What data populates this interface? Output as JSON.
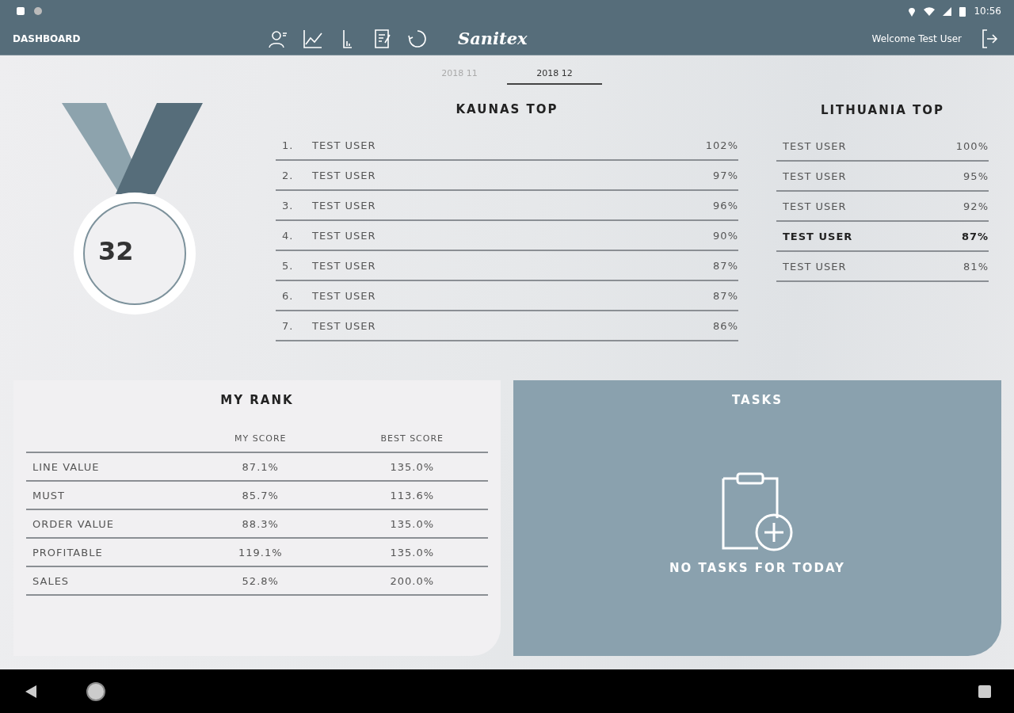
{
  "status_bar": {
    "time": "10:56"
  },
  "nav": {
    "title": "DASHBOARD",
    "brand": "Sanitex",
    "welcome": "Welcome Test User"
  },
  "periods": [
    {
      "label": "2018 11",
      "selected": false
    },
    {
      "label": "2018 12",
      "selected": true
    }
  ],
  "medal": {
    "rank": "32"
  },
  "kaunas_top": {
    "title": "KAUNAS TOP",
    "rows": [
      {
        "place": "1.",
        "name": "TEST USER",
        "score": "102%",
        "selected": false
      },
      {
        "place": "2.",
        "name": "TEST USER",
        "score": "97%",
        "selected": false
      },
      {
        "place": "3.",
        "name": "TEST USER",
        "score": "96%",
        "selected": false
      },
      {
        "place": "4.",
        "name": "TEST USER",
        "score": "90%",
        "selected": false
      },
      {
        "place": "5.",
        "name": "TEST USER",
        "score": "87%",
        "selected": false
      },
      {
        "place": "6.",
        "name": "TEST USER",
        "score": "87%",
        "selected": false
      },
      {
        "place": "7.",
        "name": "TEST USER",
        "score": "86%",
        "selected": false
      }
    ]
  },
  "lithuania_top": {
    "title": "LITHUANIA TOP",
    "rows": [
      {
        "name": "TEST USER",
        "score": "100%",
        "selected": false
      },
      {
        "name": "TEST USER",
        "score": "95%",
        "selected": false
      },
      {
        "name": "TEST USER",
        "score": "92%",
        "selected": false
      },
      {
        "name": "TEST USER",
        "score": "87%",
        "selected": true
      },
      {
        "name": "TEST USER",
        "score": "81%",
        "selected": false
      }
    ]
  },
  "my_rank": {
    "title": "MY RANK",
    "columns": [
      "MY SCORE",
      "BEST SCORE"
    ],
    "rows": [
      {
        "label": "LINE VALUE",
        "my": "87.1%",
        "best": "135.0%"
      },
      {
        "label": "MUST",
        "my": "85.7%",
        "best": "113.6%"
      },
      {
        "label": "ORDER VALUE",
        "my": "88.3%",
        "best": "135.0%"
      },
      {
        "label": "PROFITABLE",
        "my": "119.1%",
        "best": "135.0%"
      },
      {
        "label": "SALES",
        "my": "52.8%",
        "best": "200.0%"
      }
    ]
  },
  "tasks": {
    "title": "TASKS",
    "empty_message": "NO TASKS FOR TODAY"
  }
}
